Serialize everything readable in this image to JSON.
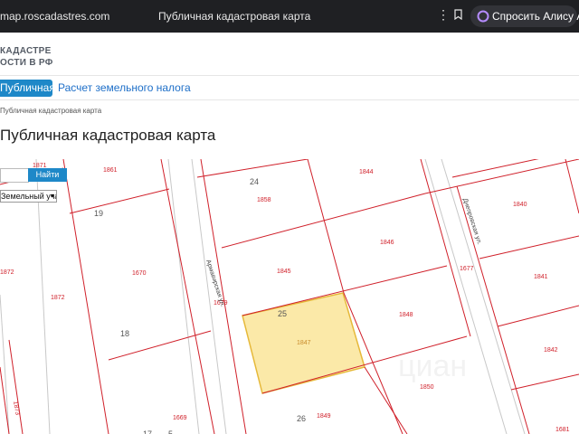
{
  "browser": {
    "url": "map.roscadastres.com",
    "page_title": "Публичная кадастровая карта",
    "menu_icon": "more-dots-icon",
    "bookmark_icon": "bookmark-icon",
    "alice_label": "Спросить Алису AI"
  },
  "site": {
    "logo_line1": "КАДАСТРЕ",
    "logo_line2": "ОСТИ В РФ"
  },
  "nav": {
    "tab_active": "Публичная кадастровая карта",
    "tab_link": "Расчет земельного налога"
  },
  "breadcrumb": "Публичная кадастровая карта",
  "page_heading": "Публичная кадастровая карта",
  "search": {
    "value": "",
    "button": "Найти",
    "select_value": "Земельный участок"
  },
  "map": {
    "highlight_color": "#fbe9a8",
    "plot_label_color": "#d0202a",
    "block_label_color": "#555555",
    "plot_labels": [
      "1871",
      "1861",
      "1844",
      "1858",
      "1840",
      "1846",
      "1872",
      "1670",
      "1845",
      "1677",
      "1841",
      "1872",
      "1679",
      "1848",
      "1847",
      "1842",
      "1873",
      "1850",
      "1669",
      "1849",
      "1681"
    ],
    "block_labels": [
      "24",
      "19",
      "25",
      "18",
      "26",
      "17",
      "5"
    ],
    "street_labels": [
      "Армавирская ул.",
      "Днепровская ул."
    ]
  }
}
